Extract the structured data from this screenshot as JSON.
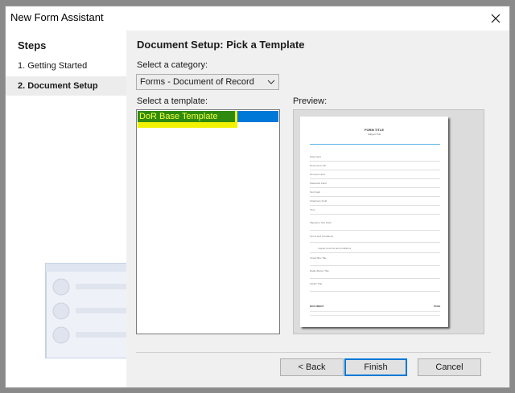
{
  "window": {
    "title": "New Form Assistant"
  },
  "sidebar": {
    "heading": "Steps",
    "steps": [
      {
        "label": "1. Getting Started",
        "active": false
      },
      {
        "label": "2. Document Setup",
        "active": true
      }
    ]
  },
  "main": {
    "header": "Document Setup: Pick a Template",
    "category_label": "Select a category:",
    "category_value": "Forms - Document of Record",
    "template_label": "Select a template:",
    "templates": [
      {
        "label": "DoR Base Template",
        "selected": true
      }
    ],
    "preview_label": "Preview:"
  },
  "buttons": {
    "back": "< Back",
    "finish": "Finish",
    "cancel": "Cancel"
  },
  "preview_doc": {
    "title": "FORM TITLE",
    "subtitle": "Subject Title",
    "fields": [
      "Date Field",
      "Document Link",
      "Numeric Field",
      "Password Field",
      "Text Field",
      "Telephone Field",
      "Time",
      "Signature Text Field",
      "Terms and Conditions",
      "I agree to terms and conditions",
      "Check Box Title",
      "Radio Button Title",
      "Switch Title",
      "DOCUMENT",
      "PAGE"
    ]
  },
  "colors": {
    "selection": "#0078d7",
    "highlight": "#f2f200",
    "finish_border": "#0078d7"
  },
  "icons": {
    "close": "close-icon",
    "dropdown": "chevron-down-icon"
  }
}
